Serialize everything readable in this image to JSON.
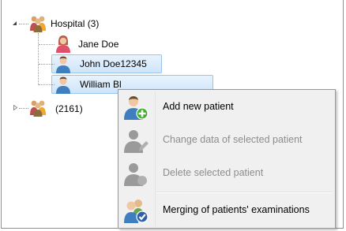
{
  "tree": {
    "root": {
      "label": "Hospital (3)",
      "expanded": true
    },
    "patients": [
      {
        "label": "Jane Doe",
        "icon": "female-patient-icon",
        "selected": false
      },
      {
        "label": "John Doe12345",
        "icon": "male-patient-icon",
        "selected": true
      },
      {
        "label": "William Bl",
        "icon": "male-patient-icon",
        "selected": true
      }
    ],
    "second_group": {
      "label": "(2161)",
      "expanded": false
    }
  },
  "context_menu": {
    "items": [
      {
        "label": "Add new patient",
        "icon": "add-patient-icon",
        "enabled": true
      },
      {
        "label": "Change data of selected patient",
        "icon": "edit-patient-icon",
        "enabled": false
      },
      {
        "label": "Delete selected patient",
        "icon": "delete-patient-icon",
        "enabled": false
      },
      {
        "label": "Merging of patients' examinations",
        "icon": "merge-patients-icon",
        "enabled": true
      }
    ]
  },
  "colors": {
    "selection_border": "#99c5ea",
    "selection_fill": "#dbecfc",
    "menu_background": "#f0f0f0",
    "disabled_text": "#8d8d8d",
    "add_badge": "#3fae2a",
    "merge_badge": "#2f5fa8"
  }
}
